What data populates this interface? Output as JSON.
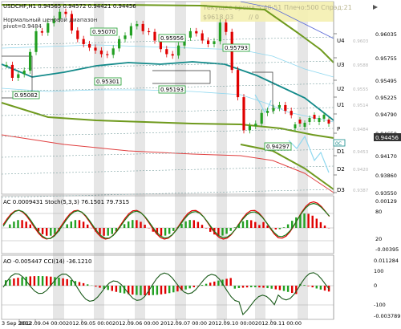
{
  "main": {
    "symbol_line": "USDCHF,H1  0.94565 0.94572 0.94421 0.94456",
    "banner_time": "Текущее время:5:48:51 Плечо:500 Спрэд:21",
    "banner_value": "$9618.03",
    "banner_pct": "// 0",
    "range_title": "Нормальный ценовой диапазон",
    "pivot_label": "pivot=0.9484",
    "current_price": "0.94456",
    "price_ticks": [
      "0.96035",
      "0.95755",
      "0.95495",
      "0.95225",
      "0.94790",
      "0.94650",
      "0.94170",
      "0.93860",
      "0.93550"
    ],
    "pivot_levels": [
      "U4",
      "U3",
      "U2",
      "U1",
      "P",
      "D1",
      "D2",
      "D3"
    ],
    "pivot_faint_values": [
      "0.9603",
      "0.9588",
      "0.9555",
      "0.9514",
      "0.9484",
      "0.9453",
      "0.9420",
      "0.9387"
    ],
    "level_badge": "0C",
    "price_labels": [
      "0.95070",
      "0.95956",
      "0.95793",
      "0.95301",
      "0.95193",
      "0.95082",
      "0.94297"
    ]
  },
  "stoch": {
    "label": "AC 0.0009431  Stoch(5,3,3) 76.1501  79.7315",
    "ticks": [
      "0.00129",
      "80",
      "20",
      "-0.00395"
    ]
  },
  "cci": {
    "label": "AO -0.005447  CCI(14) -36.1210",
    "ticks": [
      "0.011284",
      "100",
      "0",
      "-100",
      "-0.003789"
    ]
  },
  "time_axis": [
    "3 Sep 2012",
    "2012.09.04 00:00",
    "2012.09.05 00:00",
    "2012.09.06 00:00",
    "2012.09.07 00:00",
    "2012.09.10 00:00",
    "2012.09.11 00:00"
  ],
  "colors": {
    "bull": "#22a022",
    "bear": "#e00000",
    "teal": "#138a8a",
    "olive": "#6f9a1e",
    "red": "#e04040",
    "bluish": "#8fd8f0",
    "stripe": "#e6e6e6"
  },
  "chart_data": {
    "type": "line",
    "title": "USDCHF,H1",
    "approx_close_series": [
      0.9526,
      0.9508,
      0.9513,
      0.9518,
      0.9544,
      0.9573,
      0.9571,
      0.9584,
      0.959,
      0.96,
      0.9597,
      0.9574,
      0.9562,
      0.9555,
      0.955,
      0.9546,
      0.9541,
      0.954,
      0.9549,
      0.9562,
      0.9567,
      0.958,
      0.9583,
      0.9573,
      0.9572,
      0.956,
      0.9548,
      0.9541,
      0.9539,
      0.9553,
      0.9564,
      0.9573,
      0.957,
      0.956,
      0.9555,
      0.9559,
      0.9585,
      0.9572,
      0.9519,
      0.9481,
      0.9435,
      0.9441,
      0.9444,
      0.9459,
      0.9462,
      0.9466,
      0.947,
      0.9462,
      0.9456
    ]
  }
}
